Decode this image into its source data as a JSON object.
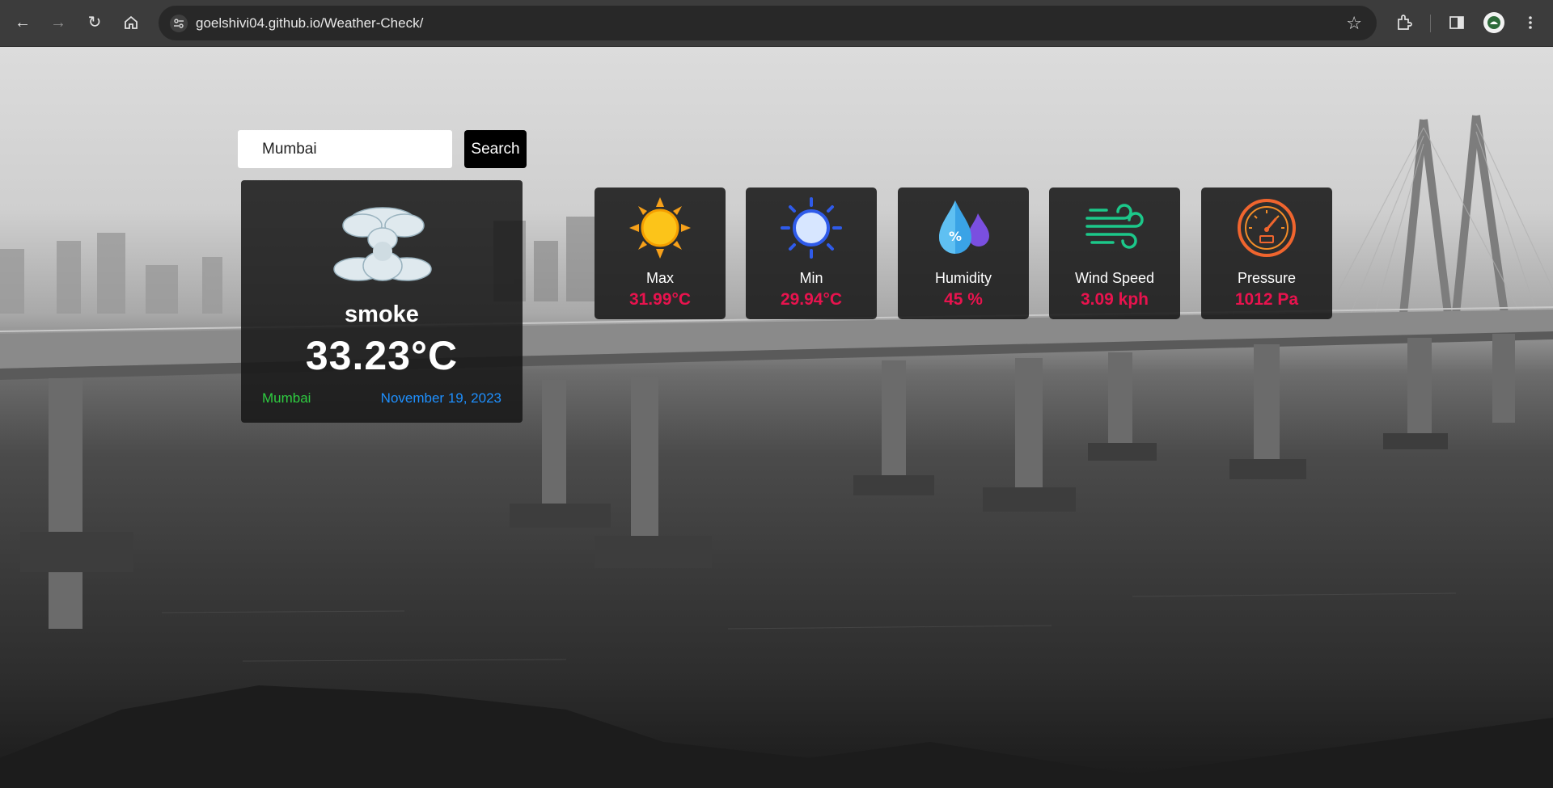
{
  "browser": {
    "url": "goelshivi04.github.io/Weather-Check/"
  },
  "search": {
    "value": "Mumbai",
    "button_label": "Search"
  },
  "current": {
    "icon": "smoke-cloud-icon",
    "condition": "smoke",
    "temperature": "33.23°C",
    "city": "Mumbai",
    "date": "November 19, 2023"
  },
  "stats": [
    {
      "label": "Max",
      "value": "31.99°C",
      "icon": "sun-icon"
    },
    {
      "label": "Min",
      "value": "29.94°C",
      "icon": "sun-outline-icon"
    },
    {
      "label": "Humidity",
      "value": "45 %",
      "icon": "humidity-drop-icon"
    },
    {
      "label": "Wind Speed",
      "value": "3.09 kph",
      "icon": "wind-icon"
    },
    {
      "label": "Pressure",
      "value": "1012 Pa",
      "icon": "pressure-gauge-icon"
    }
  ],
  "colors": {
    "stat_value": "#e8134e",
    "city": "#2ecc40",
    "date": "#1e90ff"
  }
}
